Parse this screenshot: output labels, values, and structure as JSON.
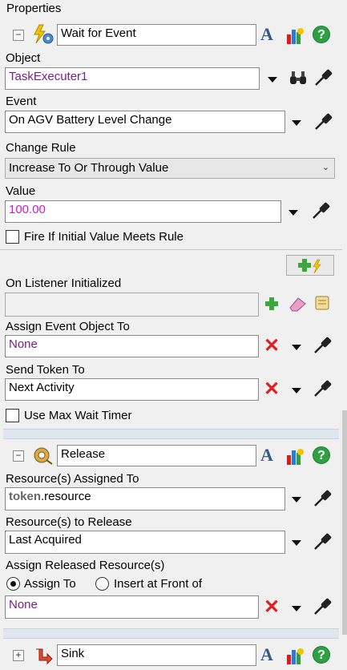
{
  "panel": {
    "title": "Properties"
  },
  "wait": {
    "name": "Wait for Event",
    "object_label": "Object",
    "object_value": "TaskExecuter1",
    "event_label": "Event",
    "event_value": "On AGV Battery Level Change",
    "change_rule_label": "Change Rule",
    "change_rule_value": "Increase To Or Through Value",
    "value_label": "Value",
    "value_value": "100.00",
    "fire_initial_label": "Fire If Initial Value Meets Rule",
    "fire_initial_checked": false,
    "on_listener_label": "On Listener Initialized",
    "on_listener_value": "",
    "assign_event_label": "Assign Event Object To",
    "assign_event_value": "None",
    "send_token_label": "Send Token To",
    "send_token_value": "Next Activity",
    "max_wait_label": "Use Max Wait Timer",
    "max_wait_checked": false
  },
  "release": {
    "name": "Release",
    "resources_assigned_label": "Resource(s) Assigned To",
    "resources_assigned_token": "token",
    "resources_assigned_rest": ".resource",
    "resources_release_label": "Resource(s) to Release",
    "resources_release_value": "Last Acquired",
    "assign_released_label": "Assign Released Resource(s)",
    "radio_assign_label": "Assign To",
    "radio_insert_label": "Insert at Front of",
    "selected_radio": "Assign To",
    "assign_value": "None"
  },
  "sink": {
    "name": "Sink"
  },
  "icons": {
    "font": "font-icon",
    "color": "color-palette-icon",
    "help": "help-icon"
  },
  "colors": {
    "purple_text": "#7a1e8c",
    "magenta_text": "#c020c0",
    "help_green": "#2ea043",
    "delete_red": "#e02020"
  }
}
